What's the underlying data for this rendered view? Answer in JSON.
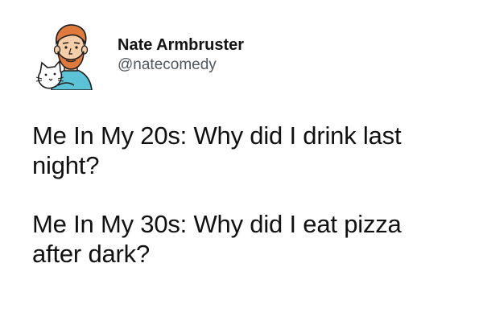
{
  "tweet": {
    "author": {
      "display_name": "Nate Armbruster",
      "handle": "@natecomedy",
      "avatar_icon": "cartoon-avatar-with-cat-icon"
    },
    "paragraphs": [
      "Me In My 20s: Why did I drink last night?",
      "Me In My 30s: Why did I eat pizza after dark?"
    ]
  },
  "colors": {
    "text": "#141414",
    "handle": "#50585f",
    "background": "#ffffff",
    "avatar_hair": "#e07a3c",
    "avatar_shirt": "#5cc3d6"
  }
}
